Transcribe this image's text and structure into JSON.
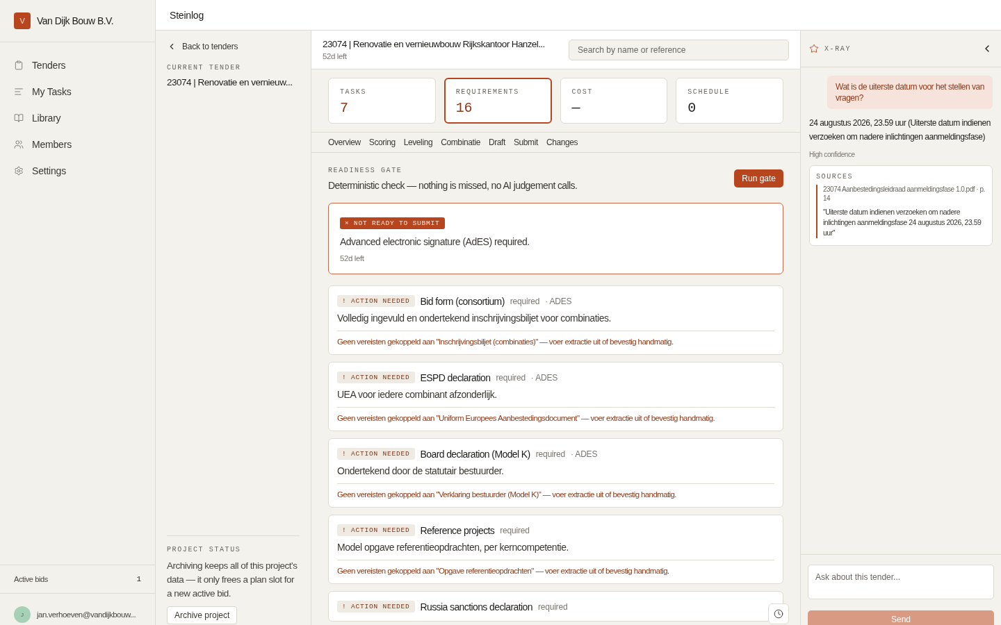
{
  "brand": {
    "initial": "V",
    "name": "Van Dijk Bouw B.V."
  },
  "nav": [
    {
      "label": "Tenders",
      "kind": "clipboard"
    },
    {
      "label": "My Tasks",
      "kind": "list"
    },
    {
      "label": "Library",
      "kind": "book"
    },
    {
      "label": "Members",
      "kind": "users"
    },
    {
      "label": "Settings",
      "kind": "gear"
    }
  ],
  "active_bids": {
    "label": "Active bids",
    "count": "1"
  },
  "user": {
    "initial": "J",
    "email": "jan.verhoeven@vandijkbouw..."
  },
  "topbar": {
    "title": "Steinlog"
  },
  "tender_nav": {
    "back": "Back to tenders",
    "current_label": "CURRENT TENDER",
    "current_title": "23074 | Renovatie en vernieuw...",
    "status_label": "PROJECT STATUS",
    "status_text": "Archiving keeps all of this project's data — it only frees a plan slot for a new active bid.",
    "archive_button": "Archive project"
  },
  "header": {
    "title": "23074 | Renovatie en vernieuwbouw Rijkskantoor Hanzel...",
    "deadline": "52d left",
    "search": {
      "placeholder": "Search by name or reference"
    }
  },
  "stats": [
    {
      "label": "TASKS",
      "value": "7",
      "selected": false,
      "accent": true
    },
    {
      "label": "REQUIREMENTS",
      "value": "16",
      "selected": true,
      "accent": true
    },
    {
      "label": "COST",
      "value": "—",
      "selected": false,
      "accent": false
    },
    {
      "label": "SCHEDULE",
      "value": "0",
      "selected": false,
      "accent": false
    }
  ],
  "tabs": [
    "Overview",
    "Scoring",
    "Leveling",
    "Combinatie",
    "Draft",
    "Submit",
    "Changes"
  ],
  "gate": {
    "label": "READINESS GATE",
    "description": "Deterministic check — nothing is missed, no AI judgement calls.",
    "button": "Run gate"
  },
  "verdict": {
    "icon": "×",
    "badge": "NOT READY TO SUBMIT",
    "message": "Advanced electronic signature (AdES) required.",
    "deadline": "52d left"
  },
  "requirements": [
    {
      "badge": "! ACTION NEEDED",
      "title": "Bid form (consortium)",
      "status": "required",
      "tag": "· ADES",
      "description": "Volledig ingevuld en ondertekend inschrijvingsbiljet voor combinaties.",
      "note": "Geen vereisten gekoppeld aan \"Inschrijvingsbiljet (combinaties)\" — voer extractie uit of bevestig handmatig."
    },
    {
      "badge": "! ACTION NEEDED",
      "title": "ESPD declaration",
      "status": "required",
      "tag": "· ADES",
      "description": "UEA voor iedere combinant afzonderlijk.",
      "note": "Geen vereisten gekoppeld aan \"Uniform Europees Aanbestedingsdocument\" — voer extractie uit of bevestig handmatig."
    },
    {
      "badge": "! ACTION NEEDED",
      "title": "Board declaration (Model K)",
      "status": "required",
      "tag": "· ADES",
      "description": "Ondertekend door de statutair bestuurder.",
      "note": "Geen vereisten gekoppeld aan \"Verklaring bestuurder (Model K)\" — voer extractie uit of bevestig handmatig."
    },
    {
      "badge": "! ACTION NEEDED",
      "title": "Reference projects",
      "status": "required",
      "description": "Model opgave referentieopdrachten, per kerncompetentie.",
      "note": "Geen vereisten gekoppeld aan \"Opgave referentieopdrachten\" — voer extractie uit of bevestig handmatig."
    },
    {
      "badge": "! ACTION NEEDED",
      "title": "Russia sanctions declaration",
      "status": "required"
    }
  ],
  "xray": {
    "title": "X-RAY",
    "question": "Wat is de uiterste datum voor het stellen van vragen?",
    "answer": "24 augustus 2026, 23.59 uur (Uiterste datum indienen verzoeken om nadere inlichtingen aanmeldingsfase)",
    "confidence": "High confidence",
    "sources_label": "SOURCES",
    "sources": [
      {
        "file": "23074 Aanbestedingsleidraad aanmeldingsfase 1.0.pdf · p. 14",
        "quote": "\"Uiterste datum indienen verzoeken om nadere inlichtingen aanmeldingsfase 24 augustus 2026, 23.59 uur\""
      }
    ],
    "input": {
      "placeholder": "Ask about this tender..."
    },
    "send": {
      "label": "Send",
      "disabled": true
    }
  }
}
